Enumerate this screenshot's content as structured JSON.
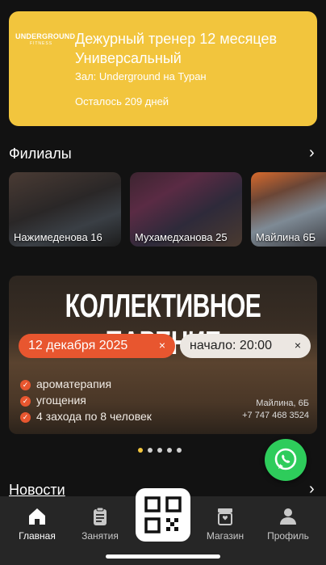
{
  "membership": {
    "logo_line1": "UNDERGROUND",
    "logo_line2": "FITNESS",
    "title": "Дежурный тренер 12 месяцев Универсальный",
    "gym": "Зал: Underground на Туран",
    "remaining": "Осталось 209 дней"
  },
  "branches": {
    "title": "Филиалы",
    "items": [
      {
        "label": "Нажимеденова 16"
      },
      {
        "label": "Мухамедханова 25"
      },
      {
        "label": "Майлина 6Б"
      }
    ]
  },
  "banner": {
    "headline": "КОЛЛЕКТИВНОЕ ПАРЕНИЕ",
    "date": "12 декабря 2025",
    "time": "начало: 20:00",
    "close_glyph": "×",
    "features": [
      "ароматерапия",
      "угощения",
      "4 захода по 8 человек"
    ],
    "address": "Майлина, 6Б",
    "phone": "+7 747 468 3524"
  },
  "carousel": {
    "count": 5,
    "active_index": 0
  },
  "news": {
    "title": "Новости"
  },
  "tabbar": {
    "items": [
      {
        "label": "Главная",
        "icon": "home-icon",
        "active": true
      },
      {
        "label": "Занятия",
        "icon": "clipboard-icon"
      },
      {
        "label": "",
        "icon": "qr-code-icon"
      },
      {
        "label": "Магазин",
        "icon": "shop-icon"
      },
      {
        "label": "Профиль",
        "icon": "profile-icon"
      }
    ]
  },
  "colors": {
    "accent": "#f2c53d",
    "background": "#121212",
    "whatsapp": "#2ecc5b",
    "banner_orange": "#e8562f"
  }
}
